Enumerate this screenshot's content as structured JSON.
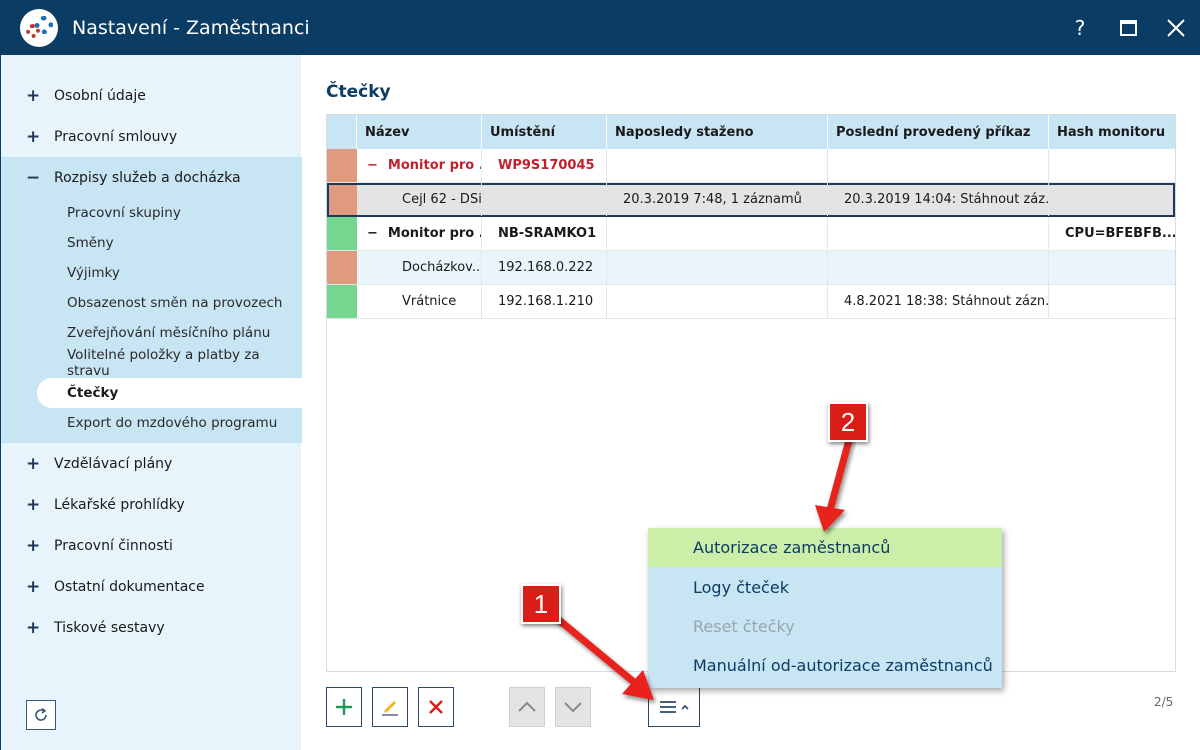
{
  "window": {
    "title": "Nastavení - Zaměstnanci",
    "help_glyph": "?",
    "close_glyph": "✕"
  },
  "sidebar": {
    "items": [
      {
        "label": "Osobní údaje",
        "toggle": "+"
      },
      {
        "label": "Pracovní smlouvy",
        "toggle": "+"
      },
      {
        "label": "Rozpisy služeb a docházka",
        "toggle": "−"
      },
      {
        "label": "Vzdělávací plány",
        "toggle": "+"
      },
      {
        "label": "Lékařské prohlídky",
        "toggle": "+"
      },
      {
        "label": "Pracovní činnosti",
        "toggle": "+"
      },
      {
        "label": "Ostatní dokumentace",
        "toggle": "+"
      },
      {
        "label": "Tiskové sestavy",
        "toggle": "+"
      }
    ],
    "subitems": [
      "Pracovní skupiny",
      "Směny",
      "Výjimky",
      "Obsazenost směn na provozech",
      "Zveřejňování měsíčního plánu",
      "Volitelné položky a platby za stravu",
      "Čtečky",
      "Export do mzdového programu"
    ]
  },
  "main": {
    "title": "Čtečky",
    "columns": [
      "Název",
      "Umístění",
      "Naposledy staženo",
      "Poslední provedený příkaz",
      "Hash monitoru"
    ],
    "rows": [
      {
        "color": "#e09a7e",
        "name": "Monitor pro ...",
        "location": "WP9S170045",
        "last": "",
        "cmd": "",
        "hash": "",
        "dash": "−"
      },
      {
        "color": "#e09a7e",
        "name": "Cejl 62 - DSi...",
        "location": "",
        "last": "20.3.2019 7:48, 1 záznamů",
        "cmd": "20.3.2019 14:04: Stáhnout záz...",
        "hash": "",
        "dash": ""
      },
      {
        "color": "#74d68f",
        "name": "Monitor pro ...",
        "location": "NB-SRAMKO1",
        "last": "",
        "cmd": "",
        "hash": "CPU=BFEBFB...",
        "dash": "−"
      },
      {
        "color": "#e09a7e",
        "name": "Docházkov...",
        "location": "192.168.0.222",
        "last": "",
        "cmd": "",
        "hash": "",
        "dash": ""
      },
      {
        "color": "#74d68f",
        "name": "Vrátnice",
        "location": "192.168.1.210",
        "last": "",
        "cmd": "4.8.2021 18:38: Stáhnout zázn...",
        "hash": "",
        "dash": ""
      }
    ],
    "page_count": "2/5"
  },
  "menu": {
    "items": [
      "Autorizace zaměstnanců",
      "Logy čteček",
      "Reset čtečky",
      "Manuální od-autorizace zaměstnanců"
    ]
  },
  "callouts": [
    "1",
    "2"
  ],
  "colors": {
    "titlebar": "#0b3c63",
    "accent_red": "#d91e18",
    "menu_hover": "#cbeea8"
  }
}
